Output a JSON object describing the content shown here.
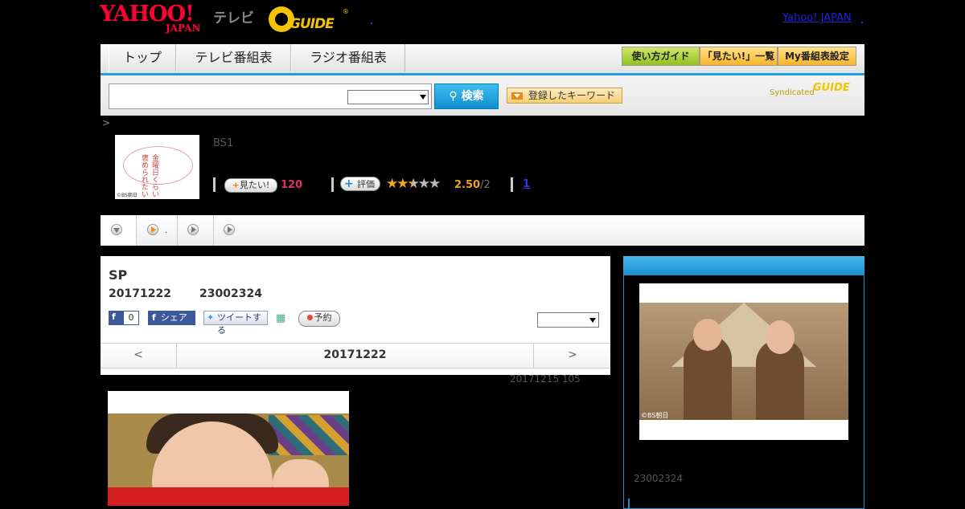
{
  "header": {
    "yahoo_logo": "YAHOO!",
    "yahoo_sub": "JAPAN",
    "tv_label": "テレビ",
    "gguide_logo": "GUIDE",
    "reg_mark": "®",
    "yahoo_japan_link": "Yahoo! JAPAN"
  },
  "nav": {
    "tabs": [
      "トップ",
      "テレビ番組表",
      "ラジオ番組表"
    ],
    "buttons": [
      "使い方ガイド",
      "「見たい!」一覧",
      "My番組表設定"
    ]
  },
  "search": {
    "button_label": "検索",
    "keyword_button": "登録したキーワード",
    "syndicated": "Syndicated",
    "gguide_small": "GUIDE"
  },
  "breadcrumb": ">",
  "program": {
    "channel": "BS1",
    "thumb_title": "金曜日くらい褒められたい",
    "thumb_copy": "©BS朝日",
    "mitai_label": "見たい!",
    "mitai_count": "120",
    "hyoka_label": "評価",
    "rating": "2.50",
    "rating_count": "/2",
    "review_link": "1",
    "stars": "★★★★★"
  },
  "tabs_row": {
    "tab2_text": "."
  },
  "episode": {
    "title": "SP",
    "date": "20171222",
    "time": "23002324",
    "fb_count": "0",
    "fb_share": "シェア",
    "tweet": "ツイートする",
    "reserve": "予約",
    "nav_prev": "<",
    "nav_date": "20171222",
    "nav_next": ">",
    "note": "20171215  105"
  },
  "sidebar": {
    "image_copy": "©BS朝日",
    "time": "23002324"
  }
}
